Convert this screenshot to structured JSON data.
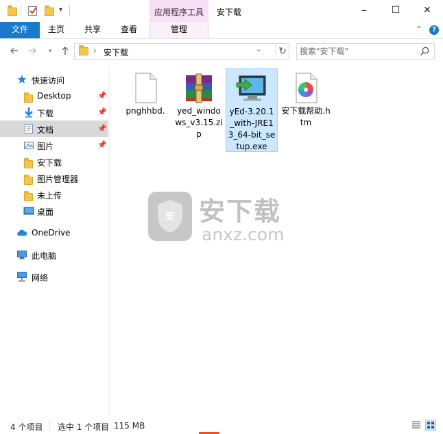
{
  "window": {
    "title": "安下载",
    "context_tab": "应用程序工具",
    "minimize_glyph": "–",
    "maximize_glyph": "☐",
    "close_glyph": "✕"
  },
  "ribbon": {
    "tabs": [
      "文件",
      "主页",
      "共享",
      "查看",
      "管理"
    ],
    "collapse_glyph": "⌃",
    "help_glyph": "?"
  },
  "address": {
    "path": "安下载",
    "separator": "›",
    "dropdown_glyph": "⌄",
    "refresh_glyph": "↻"
  },
  "search": {
    "placeholder": "搜索\"安下载\""
  },
  "sidebar": {
    "items": [
      {
        "label": "快速访问",
        "icon": "star-icon"
      },
      {
        "label": "Desktop",
        "icon": "folder-icon",
        "pinned": true
      },
      {
        "label": "下载",
        "icon": "download-arrow-icon",
        "pinned": true
      },
      {
        "label": "文档",
        "icon": "document-icon",
        "pinned": true,
        "selected": true
      },
      {
        "label": "图片",
        "icon": "picture-icon",
        "pinned": true
      },
      {
        "label": "安下载",
        "icon": "folder-icon"
      },
      {
        "label": "图片管理器",
        "icon": "folder-icon"
      },
      {
        "label": "未上传",
        "icon": "folder-icon"
      },
      {
        "label": "桌面",
        "icon": "desktop-icon"
      },
      {
        "label": "OneDrive",
        "icon": "cloud-icon"
      },
      {
        "label": "此电脑",
        "icon": "computer-icon"
      },
      {
        "label": "网络",
        "icon": "network-icon"
      }
    ]
  },
  "files": [
    {
      "name": "pnghhbd.",
      "icon": "blank-file-icon"
    },
    {
      "name": "yed_windows_v3.15.zip",
      "icon": "winrar-archive-icon"
    },
    {
      "name": "yEd-3.20.1_with-JRE13_64-bit_setup.exe",
      "icon": "installer-icon",
      "selected": true
    },
    {
      "name": "安下载帮助.htm",
      "icon": "html-file-icon"
    }
  ],
  "watermark": {
    "brand": "安下载",
    "domain": "anxz.com",
    "shield_char": "安"
  },
  "status": {
    "count": "4 个项目",
    "selection": "选中 1 个项目",
    "size": "115 MB"
  },
  "colors": {
    "accent": "#1979ca",
    "context_tab": "#f7e0f5",
    "selection": "#cce8ff"
  }
}
